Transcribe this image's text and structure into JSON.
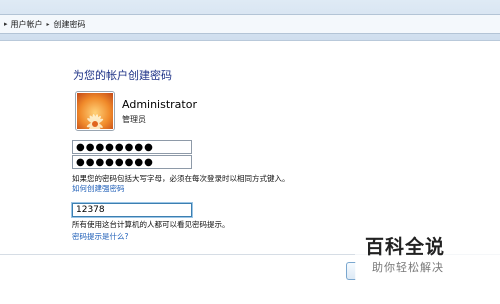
{
  "breadcrumb": {
    "items": [
      "用户帐户",
      "创建密码"
    ]
  },
  "page": {
    "title": "为您的帐户创建密码"
  },
  "user": {
    "name": "Administrator",
    "role": "管理员"
  },
  "form": {
    "password_value": "●●●●●●●●",
    "confirm_value": "●●●●●●●●",
    "caps_hint": "如果您的密码包括大写字母，必须在每次登录时以相同方式键入。",
    "strong_password_link": "如何创建强密码",
    "hint_value": "12378",
    "hint_info": "所有使用这台计算机的人都可以看见密码提示。",
    "hint_link": "密码提示是什么?"
  },
  "watermark": {
    "main": "百科全说",
    "sub": "助你轻松解决"
  },
  "colors": {
    "title": "#1e3287",
    "link": "#1f5fb8",
    "focus": "#3c7fb1"
  },
  "icons": [
    "chevron-right-icon",
    "user-flower-avatar"
  ]
}
